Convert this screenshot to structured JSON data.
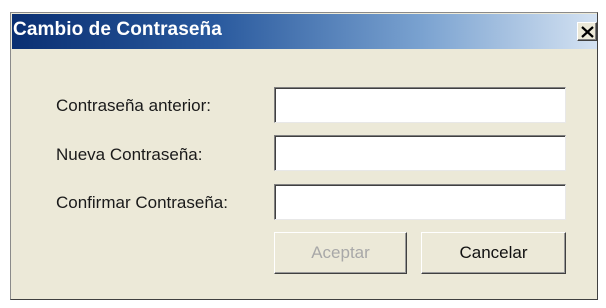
{
  "dialog": {
    "title": "Cambio de Contraseña",
    "close_glyph": "✕"
  },
  "form": {
    "old_password_label": "Contraseña anterior:",
    "old_password_value": "",
    "new_password_label": "Nueva Contraseña:",
    "new_password_value": "",
    "confirm_password_label": "Confirmar Contraseña:",
    "confirm_password_value": ""
  },
  "buttons": {
    "accept_label": "Aceptar",
    "accept_enabled": false,
    "cancel_label": "Cancelar"
  },
  "icons": {
    "close": "close-icon"
  },
  "colors": {
    "title_bar_start": "#0a2f72",
    "title_bar_end": "#d4e2f2",
    "dialog_face": "#ece9d8",
    "disabled_text": "#a8a8a8"
  }
}
